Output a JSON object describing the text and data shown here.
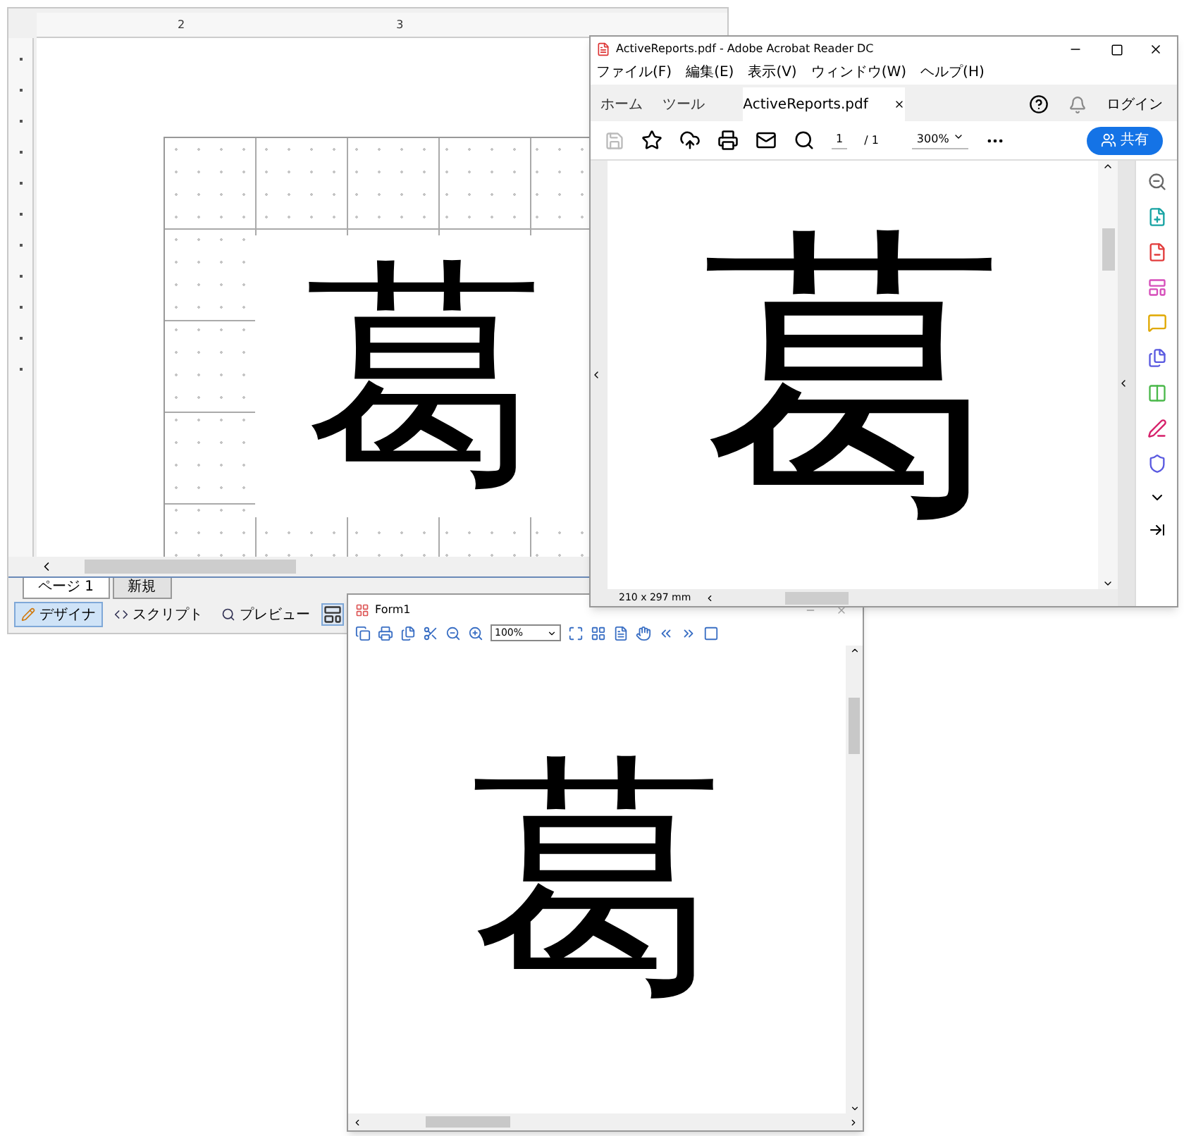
{
  "designer": {
    "ruler_labels": [
      "2",
      "3"
    ],
    "glyph": "葛",
    "page_tabs": [
      {
        "label": "ページ 1",
        "selected": true
      },
      {
        "label": "新規",
        "selected": false
      }
    ],
    "modes": [
      {
        "label": "デザイナ",
        "selected": true
      },
      {
        "label": "スクリプト",
        "selected": false
      },
      {
        "label": "プレビュー",
        "selected": false
      }
    ]
  },
  "acrobat": {
    "title": "ActiveReports.pdf - Adobe Acrobat Reader DC",
    "menu": [
      "ファイル(F)",
      "編集(E)",
      "表示(V)",
      "ウィンドウ(W)",
      "ヘルプ(H)"
    ],
    "tabs": [
      {
        "label": "ホーム",
        "selected": false
      },
      {
        "label": "ツール",
        "selected": false
      },
      {
        "label": "ActiveReports.pdf",
        "selected": true
      }
    ],
    "login": "ログイン",
    "page": "1",
    "page_total": "/ 1",
    "zoom": "300%",
    "share": "共有",
    "glyph": "葛",
    "page_size": "210 x 297 mm"
  },
  "form": {
    "title": "Form1",
    "zoom": "100%",
    "glyph": "葛"
  }
}
